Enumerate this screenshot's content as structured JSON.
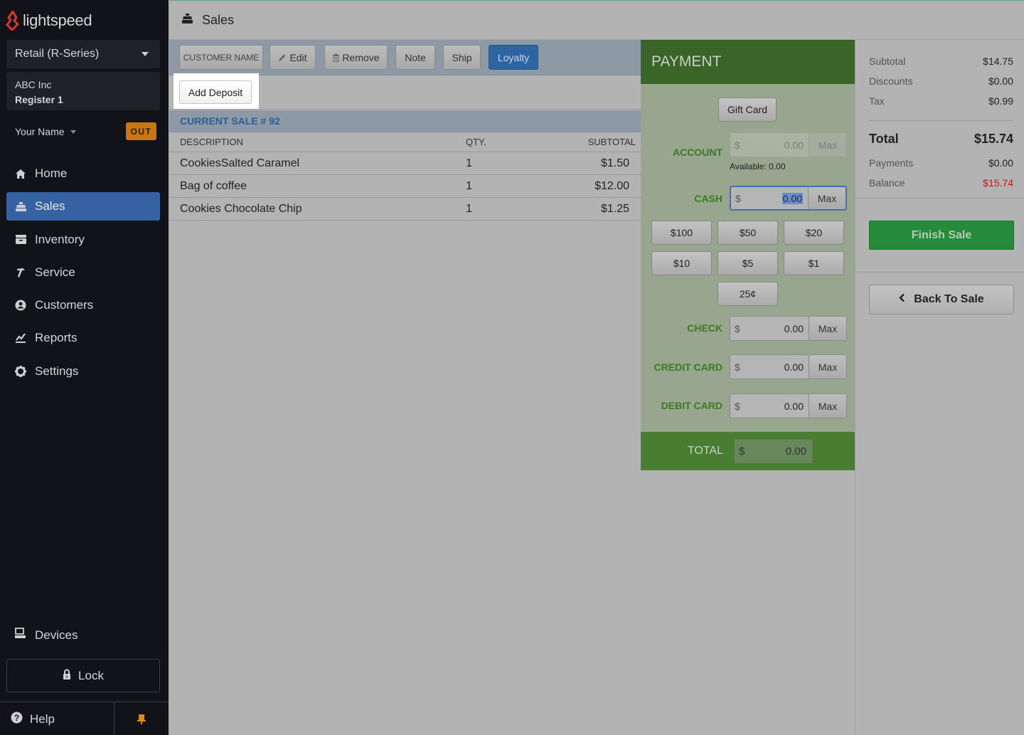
{
  "app": {
    "brand": "lightspeed",
    "brand_color": "#d8352b",
    "accent_color": "#3661a3"
  },
  "sidebar": {
    "store_select": "Retail (R-Series)",
    "company": "ABC Inc",
    "register": "Register 1",
    "user_name": "Your Name",
    "status_badge": "OUT",
    "nav": [
      {
        "label": "Home",
        "icon": "home-icon",
        "active": false
      },
      {
        "label": "Sales",
        "icon": "cash-register-icon",
        "active": true
      },
      {
        "label": "Inventory",
        "icon": "archive-box-icon",
        "active": false
      },
      {
        "label": "Service",
        "icon": "hammer-icon",
        "active": false
      },
      {
        "label": "Customers",
        "icon": "user-circle-icon",
        "active": false
      },
      {
        "label": "Reports",
        "icon": "chart-line-icon",
        "active": false
      },
      {
        "label": "Settings",
        "icon": "gear-icon",
        "active": false
      }
    ],
    "devices_label": "Devices",
    "lock_label": "Lock",
    "help_label": "Help"
  },
  "header": {
    "title": "Sales"
  },
  "toolbar": {
    "customer_name": "CUSTOMER NAME",
    "edit": "Edit",
    "remove": "Remove",
    "note": "Note",
    "ship": "Ship",
    "loyalty": "Loyalty",
    "add_deposit": "Add Deposit"
  },
  "sale": {
    "title": "CURRENT SALE # 92",
    "columns": {
      "description": "DESCRIPTION",
      "qty": "QTY.",
      "subtotal": "SUBTOTAL"
    },
    "items": [
      {
        "description": "CookiesSalted Caramel",
        "qty": "1",
        "subtotal": "$1.50"
      },
      {
        "description": "Bag of coffee",
        "qty": "1",
        "subtotal": "$12.00"
      },
      {
        "description": "Cookies Chocolate Chip",
        "qty": "1",
        "subtotal": "$1.25"
      }
    ]
  },
  "payment": {
    "title": "PAYMENT",
    "gift_card": "Gift Card",
    "currency": "$",
    "max_label": "Max",
    "account": {
      "label": "ACCOUNT",
      "value": "0.00",
      "available": "Available: 0.00"
    },
    "cash": {
      "label": "CASH",
      "value": "0.00"
    },
    "quick_cash": [
      "$100",
      "$50",
      "$20",
      "$10",
      "$5",
      "$1",
      "25¢"
    ],
    "check": {
      "label": "CHECK",
      "value": "0.00"
    },
    "credit_card": {
      "label": "CREDIT CARD",
      "value": "0.00"
    },
    "debit_card": {
      "label": "DEBIT CARD",
      "value": "0.00"
    },
    "total": {
      "label": "TOTAL",
      "value": "0.00"
    }
  },
  "summary": {
    "subtotal": {
      "label": "Subtotal",
      "value": "$14.75"
    },
    "discounts": {
      "label": "Discounts",
      "value": "$0.00"
    },
    "tax": {
      "label": "Tax",
      "value": "$0.99"
    },
    "total": {
      "label": "Total",
      "value": "$15.74"
    },
    "payments": {
      "label": "Payments",
      "value": "$0.00"
    },
    "balance": {
      "label": "Balance",
      "value": "$15.74",
      "color": "#c8141c"
    },
    "finish_sale": "Finish Sale",
    "back_to_sale": "Back To Sale"
  }
}
